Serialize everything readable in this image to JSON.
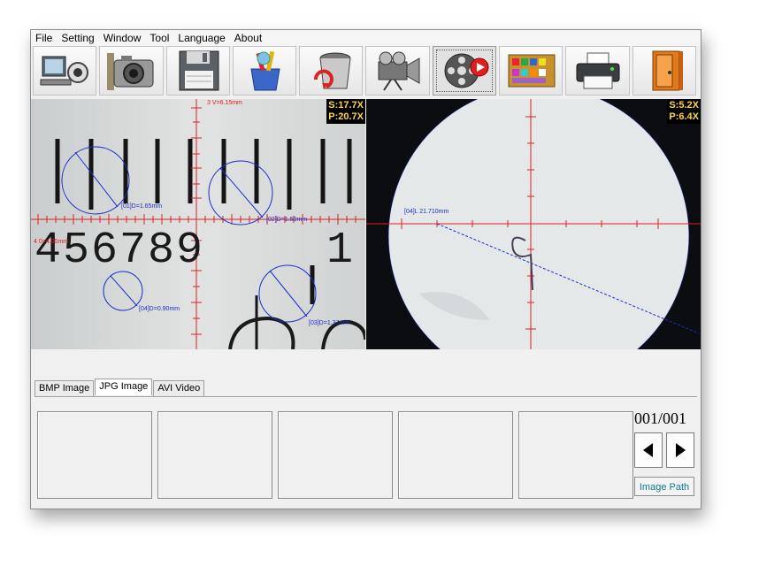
{
  "menu": {
    "items": [
      "File",
      "Setting",
      "Window",
      "Tool",
      "Language",
      "About"
    ]
  },
  "toolbar": {
    "buttons": [
      {
        "name": "pc-camera-icon"
      },
      {
        "name": "camera-icon"
      },
      {
        "name": "floppy-disk-icon"
      },
      {
        "name": "paint-tools-icon"
      },
      {
        "name": "recycle-bin-icon"
      },
      {
        "name": "video-camera-icon"
      },
      {
        "name": "film-reel-record-icon"
      },
      {
        "name": "color-palette-icon"
      },
      {
        "name": "printer-icon"
      },
      {
        "name": "exit-door-icon"
      }
    ]
  },
  "left_view": {
    "scale": "S:17.7X",
    "pixel": "P:20.7X",
    "digits": "456789",
    "digit_right": "1",
    "top_label": "3 V=6.15mm",
    "measure_01": "[01]D=1.65mm",
    "measure_02": "[02]D=1.50mm",
    "measure_03": "[03]D=1.37mm",
    "measure_04": "[04]D=0.90mm",
    "left_label": "4 0=4.00mm"
  },
  "right_view": {
    "scale": "S:5.2X",
    "pixel": "P:6.4X",
    "measure_04": "[04]L 21.710mm"
  },
  "tabs": {
    "items": [
      "BMP Image",
      "JPG Image",
      "AVI Video"
    ],
    "active": "JPG Image"
  },
  "pager": {
    "counter": "001/001",
    "image_path_label": "Image Path"
  },
  "colors": {
    "reticle": "#e02020",
    "measure": "#1a2fc8",
    "readout": "#ffd54a"
  }
}
